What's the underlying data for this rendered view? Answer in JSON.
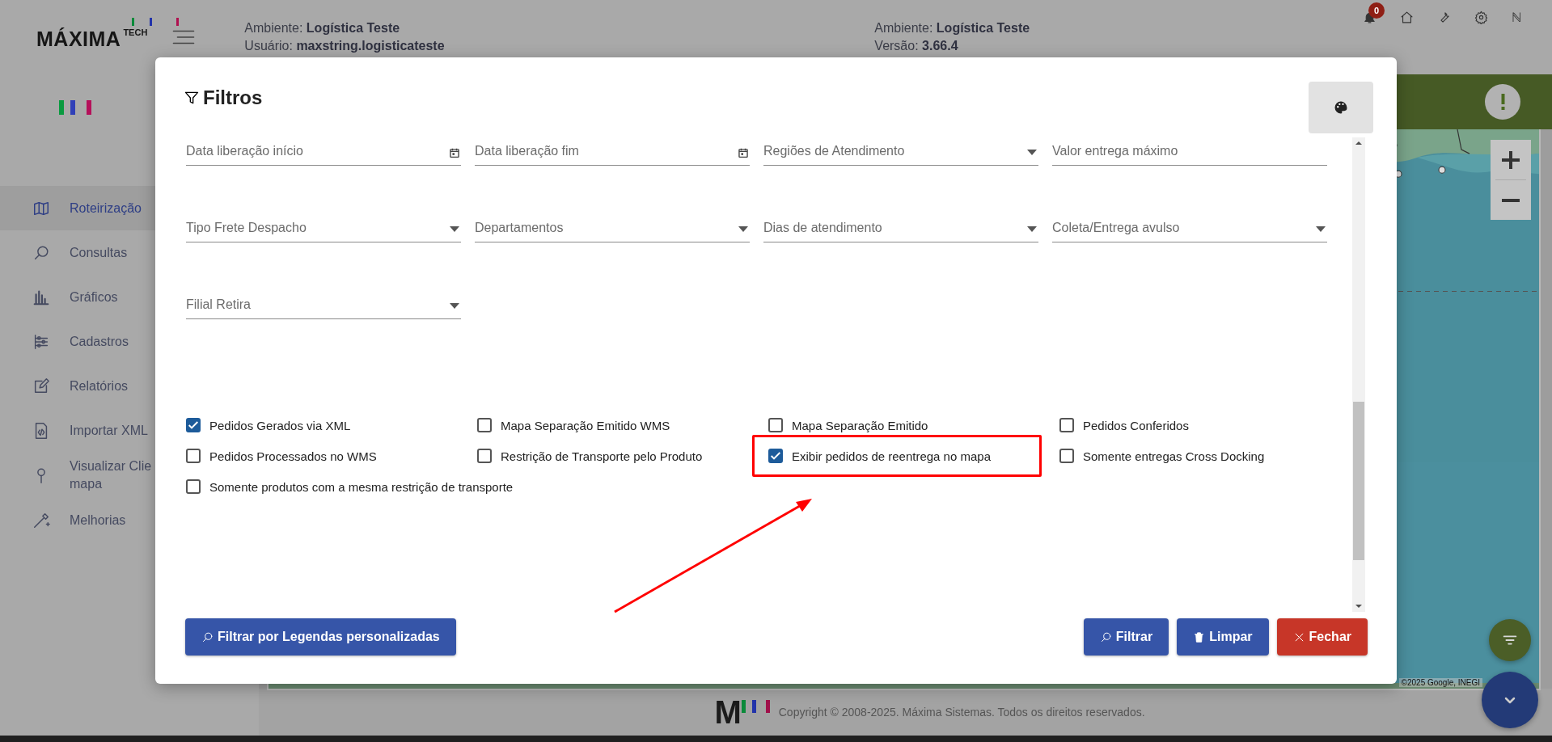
{
  "header": {
    "logo": {
      "name": "MÁXIMA",
      "suffix": "TECH"
    },
    "info_left": [
      {
        "label": "Ambiente:",
        "value": "Logística Teste"
      },
      {
        "label": "Usuário:",
        "value": "maxstring.logisticateste"
      }
    ],
    "info_right": [
      {
        "label": "Ambiente:",
        "value": "Logística Teste"
      },
      {
        "label": "Versão:",
        "value": "3.66.4"
      }
    ],
    "notifications": "0",
    "toolbar": [
      {
        "kind": "home"
      },
      {
        "kind": "tools"
      },
      {
        "kind": "settings"
      },
      {
        "kind": "letter",
        "text": "ℕ"
      }
    ]
  },
  "sidebar": {
    "items": [
      {
        "label": "Roteirização",
        "selected": true
      },
      {
        "label": "Consultas",
        "selected": false
      },
      {
        "label": "Gráficos",
        "selected": false
      },
      {
        "label": "Cadastros",
        "selected": false
      },
      {
        "label": "Relatórios",
        "selected": false
      },
      {
        "label": "Importar XML",
        "selected": false
      },
      {
        "label": "Visualizar Clie mapa",
        "selected": false
      },
      {
        "label": "Melhorias",
        "selected": false
      }
    ]
  },
  "map": {
    "attribution": "©2025 Google, INEGI"
  },
  "modal": {
    "title": "Filtros",
    "fields": [
      {
        "placeholder": "Data liberação início",
        "kind": "date"
      },
      {
        "placeholder": "Data liberação fim",
        "kind": "date"
      },
      {
        "placeholder": "Regiões de Atendimento",
        "kind": "select"
      },
      {
        "placeholder": "Valor entrega máximo",
        "kind": "text"
      },
      {
        "placeholder": "Tipo Frete Despacho",
        "kind": "select"
      },
      {
        "placeholder": "Departamentos",
        "kind": "select"
      },
      {
        "placeholder": "Dias de atendimento",
        "kind": "select"
      },
      {
        "placeholder": "Coleta/Entrega avulso",
        "kind": "select"
      },
      {
        "placeholder": "Filial Retira",
        "kind": "select"
      }
    ],
    "checkboxes": [
      {
        "label": "Pedidos Gerados via XML",
        "checked": true,
        "highlighted": false
      },
      {
        "label": "Mapa Separação Emitido WMS",
        "checked": false,
        "highlighted": false
      },
      {
        "label": "Mapa Separação Emitido",
        "checked": false,
        "highlighted": false
      },
      {
        "label": "Pedidos Conferidos",
        "checked": false,
        "highlighted": false
      },
      {
        "label": "Pedidos Processados no WMS",
        "checked": false,
        "highlighted": false
      },
      {
        "label": "Restrição de Transporte pelo Produto",
        "checked": false,
        "highlighted": false
      },
      {
        "label": "Exibir pedidos de reentrega no mapa",
        "checked": true,
        "highlighted": true
      },
      {
        "label": "Somente entregas Cross Docking",
        "checked": false,
        "highlighted": false
      },
      {
        "label": "Somente produtos com a mesma restrição de transporte",
        "checked": false,
        "highlighted": false
      }
    ],
    "buttons": [
      {
        "label": "Filtrar por Legendas personalizadas",
        "kind": "legend"
      },
      {
        "label": "Filtrar",
        "kind": "search"
      },
      {
        "label": "Limpar",
        "kind": "clear"
      },
      {
        "label": "Fechar",
        "kind": "close"
      }
    ]
  },
  "annotations": [
    {
      "kind": "arrow"
    }
  ],
  "footer": {
    "mark": "M",
    "copyright": "Copyright © 2008-2025. Máxima Sistemas. Todos os direitos reservados."
  }
}
